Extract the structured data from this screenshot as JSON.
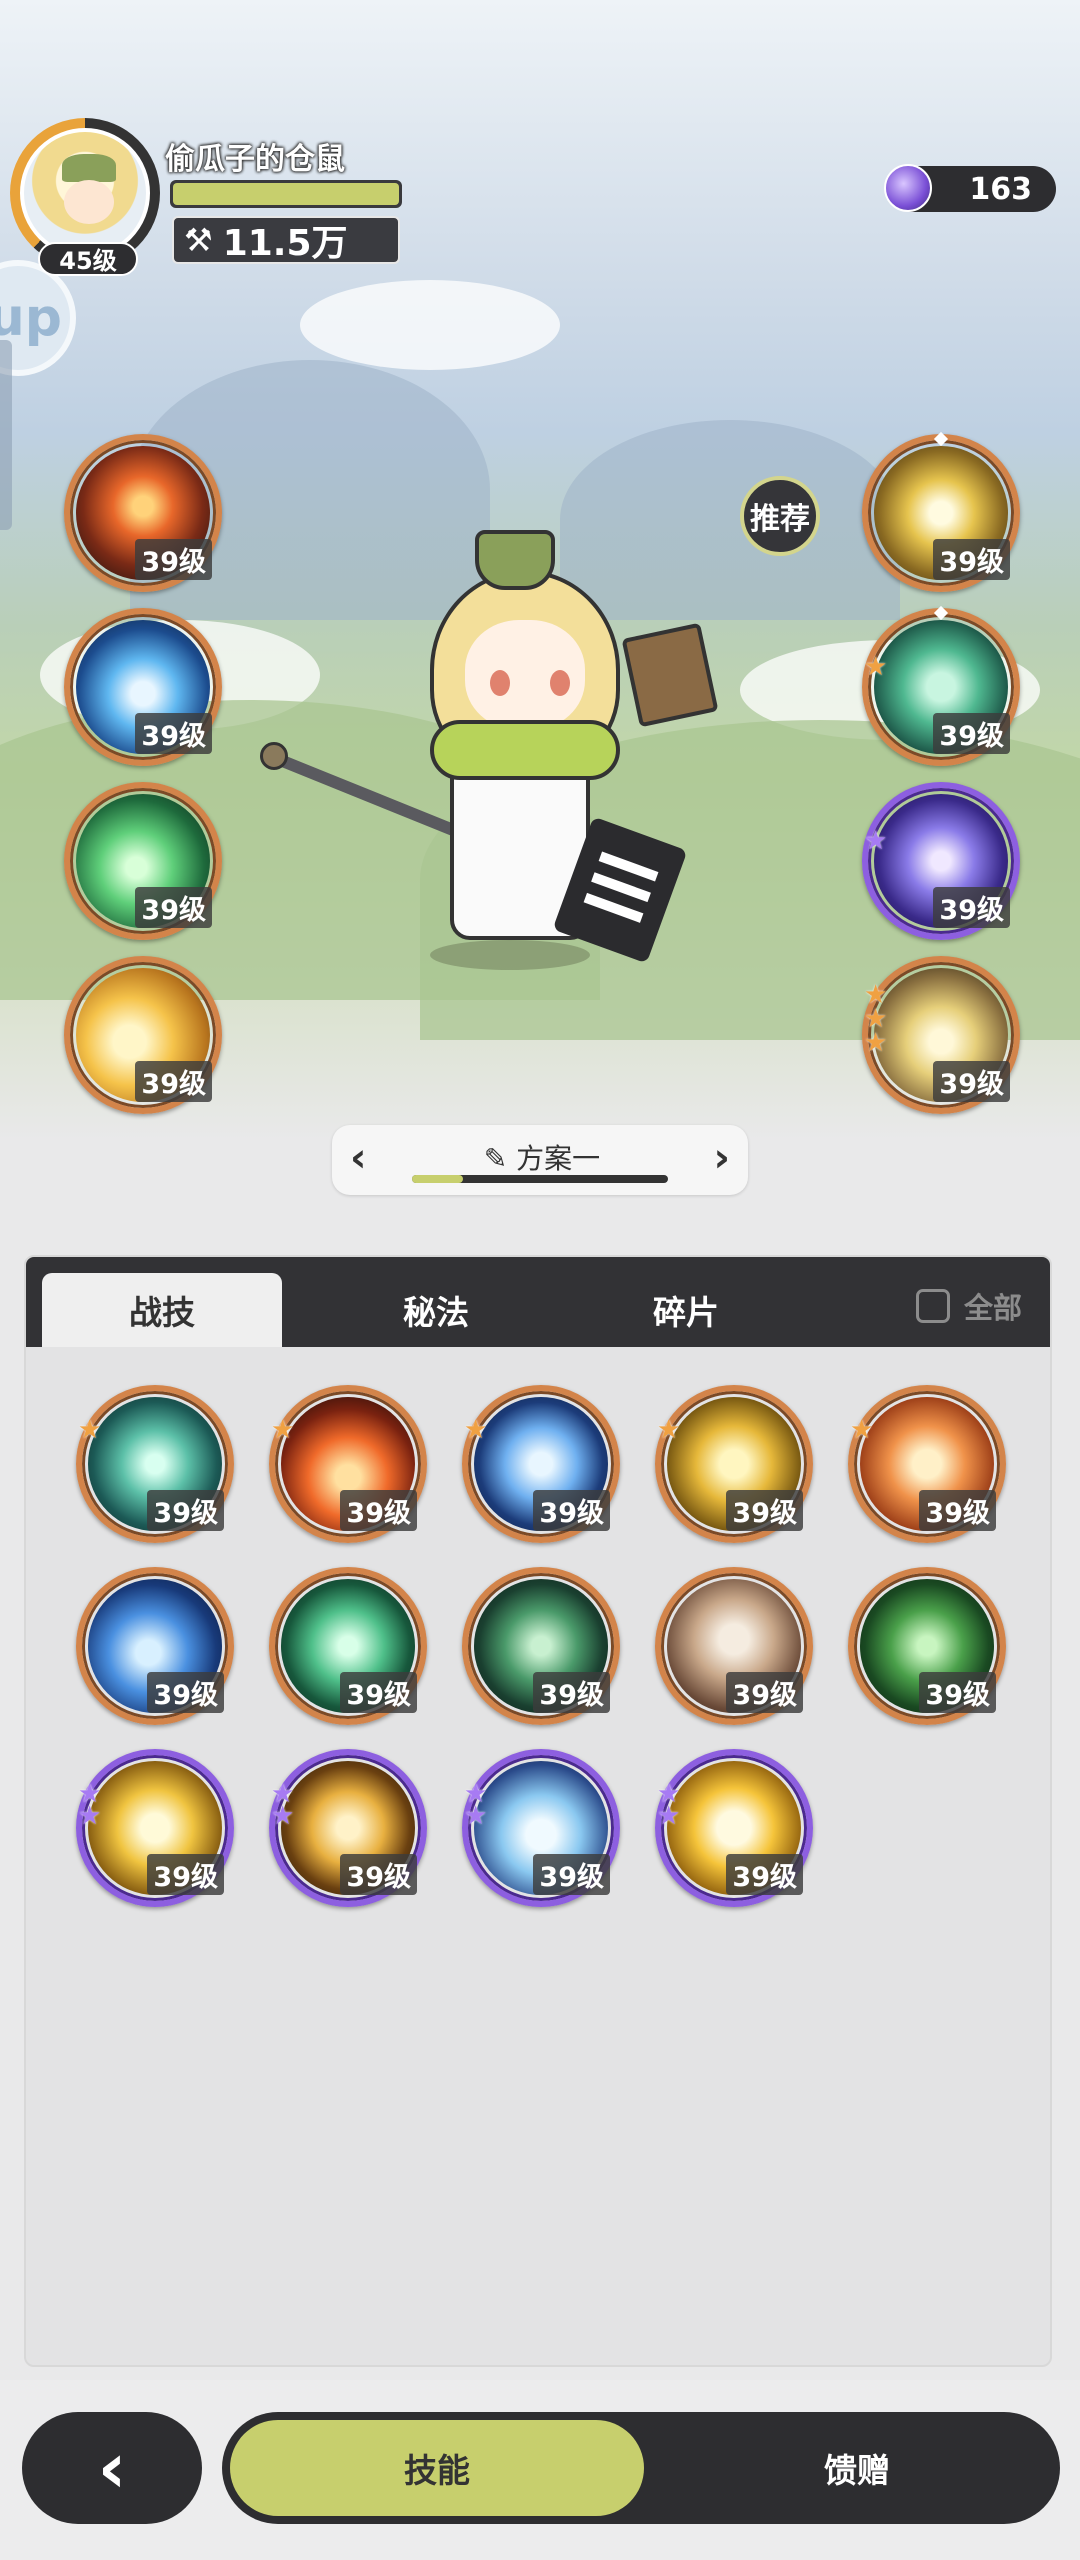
{
  "player": {
    "name": "偷瓜子的仓鼠",
    "level_label": "45级",
    "power": "11.5万",
    "xp_fraction": 1.0
  },
  "currency": {
    "amount": "163",
    "icon": "purple-gem-icon"
  },
  "recommend_label": "推荐",
  "equipped_left": [
    {
      "level": "39级",
      "icon": "fire-swirl-icon",
      "stars": 0
    },
    {
      "level": "39级",
      "icon": "ice-burst-icon",
      "stars": 0
    },
    {
      "level": "39级",
      "icon": "wind-slash-icon",
      "stars": 0
    },
    {
      "level": "39级",
      "icon": "light-strike-icon",
      "stars": 0
    }
  ],
  "equipped_right": [
    {
      "level": "39级",
      "icon": "gold-shatter-icon",
      "stars": 0
    },
    {
      "level": "39级",
      "icon": "leaf-ward-icon",
      "stars": 1
    },
    {
      "level": "39级",
      "icon": "starry-field-icon",
      "stars": 1
    },
    {
      "level": "39级",
      "icon": "golden-spikes-icon",
      "stars": 3
    }
  ],
  "plan": {
    "name": "方案一",
    "progress_fraction": 0.2
  },
  "tabs": [
    {
      "label": "战技",
      "active": true
    },
    {
      "label": "秘法",
      "active": false
    },
    {
      "label": "碎片",
      "active": false
    }
  ],
  "filter": {
    "label": "全部",
    "checked": false
  },
  "skills": [
    {
      "level": "39级",
      "icon": "green-vortex-icon",
      "tier": "orange",
      "stars": 1
    },
    {
      "level": "39级",
      "icon": "fire-blast-icon",
      "tier": "orange",
      "stars": 1
    },
    {
      "level": "39级",
      "icon": "ice-crystal-icon",
      "tier": "orange",
      "stars": 1
    },
    {
      "level": "39级",
      "icon": "golden-pyramid-icon",
      "tier": "orange",
      "stars": 1
    },
    {
      "level": "39级",
      "icon": "fire-orb-icon",
      "tier": "orange",
      "stars": 1
    },
    {
      "level": "39级",
      "icon": "blue-flame-icon",
      "tier": "orange",
      "stars": 0
    },
    {
      "level": "39级",
      "icon": "green-claws-icon",
      "tier": "orange",
      "stars": 0
    },
    {
      "level": "39级",
      "icon": "thorn-vine-icon",
      "tier": "orange",
      "stars": 0
    },
    {
      "level": "39级",
      "icon": "rock-card-icon",
      "tier": "orange",
      "stars": 0
    },
    {
      "level": "39级",
      "icon": "healing-cross-icon",
      "tier": "orange",
      "stars": 0
    },
    {
      "level": "39级",
      "icon": "light-burst-icon",
      "tier": "purple",
      "stars": 2
    },
    {
      "level": "39级",
      "icon": "chain-lightning-icon",
      "tier": "purple",
      "stars": 2
    },
    {
      "level": "39级",
      "icon": "ice-spikes-icon",
      "tier": "purple",
      "stars": 2
    },
    {
      "level": "39级",
      "icon": "golden-sun-icon",
      "tier": "purple",
      "stars": 2
    }
  ],
  "nav": {
    "back_icon": "chevron-left-icon",
    "skill_label": "技能",
    "gift_label": "馈赠"
  },
  "colors": {
    "accent": "#c7cf6d",
    "dark": "#2d2d30",
    "orange_frame": "#d3844a",
    "purple_frame": "#8d5fe0"
  }
}
